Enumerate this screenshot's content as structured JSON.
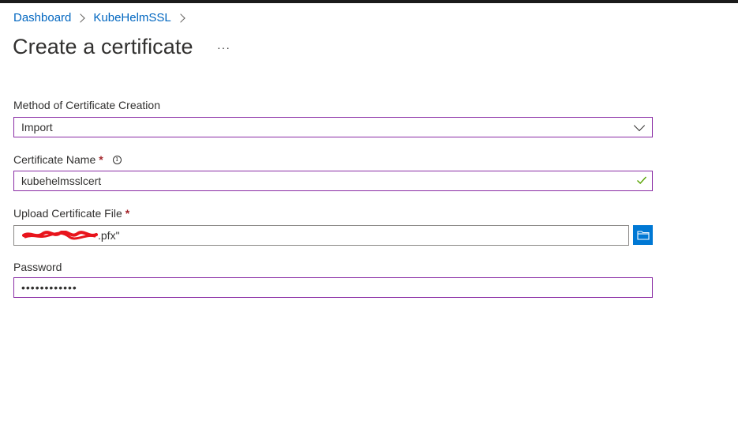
{
  "breadcrumb": {
    "items": [
      "Dashboard",
      "KubeHelmSSL"
    ]
  },
  "page": {
    "title": "Create a certificate",
    "more": "···"
  },
  "form": {
    "method": {
      "label": "Method of Certificate Creation",
      "value": "Import"
    },
    "cert_name": {
      "label": "Certificate Name",
      "required_mark": "*",
      "info": "i",
      "value": "kubehelmsslcert"
    },
    "upload": {
      "label": "Upload Certificate File",
      "required_mark": "*",
      "value_suffix": ".pfx\""
    },
    "password": {
      "label": "Password",
      "value": "••••••••••••"
    }
  },
  "colors": {
    "link": "#0066c0",
    "focus_border": "#8a2da5",
    "primary": "#0078d4",
    "required": "#a4262c",
    "success": "#57a300",
    "redaction": "#e8141c"
  }
}
